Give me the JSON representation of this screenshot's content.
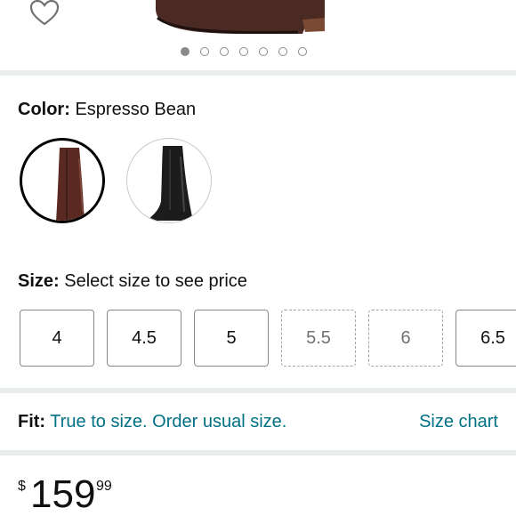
{
  "gallery": {
    "dot_count": 7,
    "active_index": 0
  },
  "color": {
    "label": "Color:",
    "value": "Espresso Bean",
    "swatches": [
      {
        "name": "Espresso Bean",
        "color": "#5a2a22",
        "selected": true
      },
      {
        "name": "Black",
        "color": "#1c1c1c",
        "selected": false
      }
    ]
  },
  "size": {
    "label": "Size:",
    "hint": "Select size to see price",
    "options": [
      {
        "label": "4",
        "available": true
      },
      {
        "label": "4.5",
        "available": true
      },
      {
        "label": "5",
        "available": true
      },
      {
        "label": "5.5",
        "available": false
      },
      {
        "label": "6",
        "available": false
      },
      {
        "label": "6.5",
        "available": true
      }
    ]
  },
  "fit": {
    "label": "Fit:",
    "text": "True to size. Order usual size.",
    "size_chart": "Size chart"
  },
  "price": {
    "symbol": "$",
    "whole": "159",
    "fraction": "99"
  },
  "colors": {
    "link": "#007185",
    "separator": "#eaeded"
  }
}
